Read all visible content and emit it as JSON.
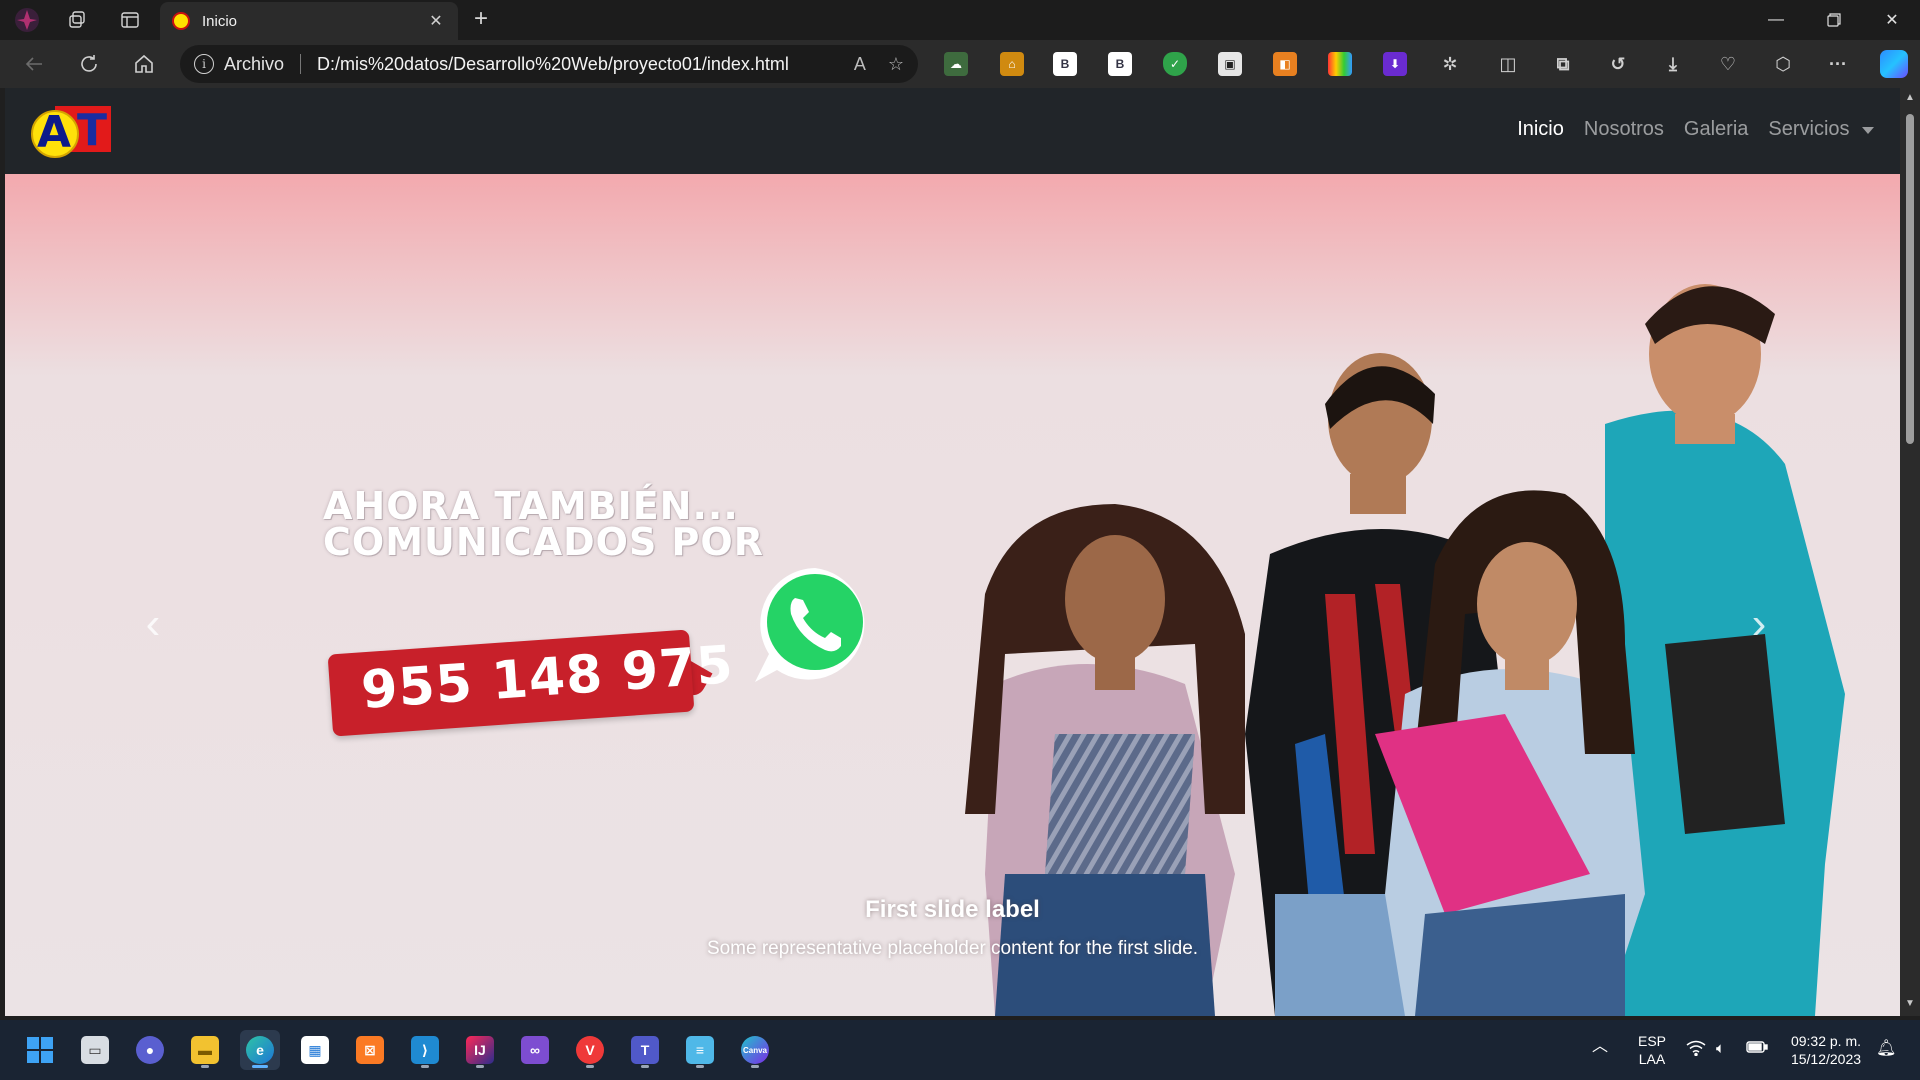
{
  "browser": {
    "tab_title": "Inicio",
    "address_site_label": "Archivo",
    "address_url": "D:/mis%20datos/Desarrollo%20Web/proyecto01/index.html"
  },
  "site": {
    "nav": {
      "links": [
        "Inicio",
        "Nosotros",
        "Galeria",
        "Servicios"
      ],
      "active": "Inicio"
    },
    "hero": {
      "promo_line_1": "AHORA TAMBIÉN...",
      "promo_line_2": "COMUNICADOS POR",
      "phone_number": "955 148 975",
      "caption_title": "First slide label",
      "caption_text": "Some representative placeholder content for the first slide."
    }
  },
  "taskbar": {
    "language": "ESP",
    "layout": "LAA",
    "time": "09:32 p. m.",
    "date": "15/12/2023"
  },
  "colors": {
    "site_nav_bg": "#212529",
    "hero_pink": "#f3a9ae",
    "phone_tag_red": "#c8202a",
    "whatsapp_green": "#25d366"
  }
}
